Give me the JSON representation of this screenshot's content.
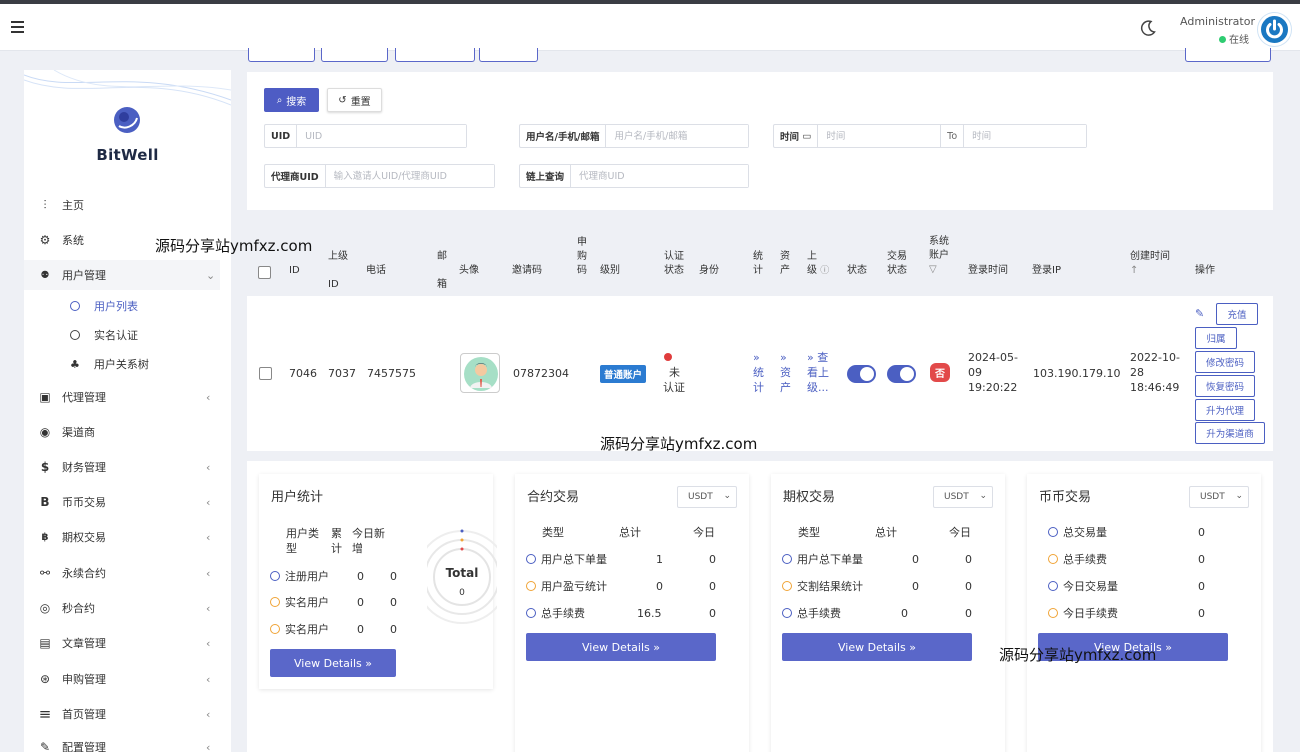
{
  "header": {
    "admin_name": "Administrator",
    "status": "在线"
  },
  "sidebar": {
    "logo": "BitWell",
    "items": [
      {
        "label": "主页",
        "icon": "chart-icon",
        "glyph": "⫶"
      },
      {
        "label": "系统",
        "icon": "gear-icon",
        "glyph": "⚙"
      },
      {
        "label": "用户管理",
        "icon": "users-icon",
        "glyph": "👥"
      },
      {
        "label": "代理管理",
        "icon": "id-card-icon",
        "glyph": "▣"
      },
      {
        "label": "渠道商",
        "icon": "user-circle-icon",
        "glyph": "◉"
      },
      {
        "label": "财务管理",
        "icon": "dollar-icon",
        "glyph": "$"
      },
      {
        "label": "币币交易",
        "icon": "bitcoin-icon",
        "glyph": "B"
      },
      {
        "label": "期权交易",
        "icon": "bitcoin-small-icon",
        "glyph": "฿"
      },
      {
        "label": "永续合约",
        "icon": "link-icon",
        "glyph": "⚯"
      },
      {
        "label": "秒合约",
        "icon": "target-icon",
        "glyph": "◎"
      },
      {
        "label": "文章管理",
        "icon": "newspaper-icon",
        "glyph": "▤"
      },
      {
        "label": "申购管理",
        "icon": "lifebuoy-icon",
        "glyph": "⊛"
      },
      {
        "label": "首页管理",
        "icon": "list-icon",
        "glyph": "≡"
      },
      {
        "label": "配置管理",
        "icon": "wrench-icon",
        "glyph": "✎"
      }
    ],
    "sub_items": [
      "用户列表",
      "实名认证",
      "用户关系树"
    ]
  },
  "filters": {
    "search_label": "搜索",
    "reset_label": "重置",
    "uid": {
      "label": "UID",
      "placeholder": "UID"
    },
    "username": {
      "label": "用户名/手机/邮箱",
      "placeholder": "用户名/手机/邮箱"
    },
    "time": {
      "label": "时间",
      "placeholder_from": "时间",
      "to": "To",
      "placeholder_to": "时间"
    },
    "agent_uid": {
      "label": "代理商UID",
      "placeholder": "输入邀请人UID/代理商UID"
    },
    "chain_query": {
      "label": "链上查询",
      "placeholder": "代理商UID"
    }
  },
  "table": {
    "headers": {
      "id": "ID",
      "parent_id_1": "上级",
      "parent_id_2": "ID",
      "phone": "电话",
      "email_1": "邮",
      "email_2": "箱",
      "avatar": "头像",
      "invite_code": "邀请码",
      "apply_code_1": "申",
      "apply_code_2": "购",
      "apply_code_3": "码",
      "level": "级别",
      "auth_1": "认证",
      "auth_2": "状态",
      "identity": "身份",
      "stats_1": "统",
      "stats_2": "计",
      "assets_1": "资",
      "assets_2": "产",
      "parent_1": "上",
      "parent_2": "级",
      "status": "状态",
      "trade_1": "交易",
      "trade_2": "状态",
      "sys_1": "系统",
      "sys_2": "账户",
      "login_time": "登录时间",
      "login_ip": "登录IP",
      "created": "创建时间",
      "ops": "操作"
    },
    "row": {
      "id": "7046",
      "parent_id": "7037",
      "phone": "7457575",
      "invite_code": "07872304",
      "level": "普通账户",
      "auth_1": "未",
      "auth_2": "认证",
      "stats_1": "统",
      "stats_2": "计",
      "assets_1": "资",
      "assets_2": "产",
      "parent_1": "查",
      "parent_2": "看上",
      "parent_3": "级...",
      "sys_account": "否",
      "login_time_1": "2024-05-",
      "login_time_2": "09",
      "login_time_3": "19:20:22",
      "login_ip": "103.190.179.10",
      "created_1": "2022-10-",
      "created_2": "28",
      "created_3": "18:46:49",
      "ops": [
        "充值",
        "归属",
        "修改密码",
        "恢复密码",
        "升为代理",
        "升为渠道商"
      ]
    }
  },
  "user_stats": {
    "title": "用户统计",
    "col_type_1": "用户类",
    "col_type_2": "型",
    "col_total_1": "累",
    "col_total_2": "计",
    "col_today_1": "今日新",
    "col_today_2": "增",
    "rows": [
      {
        "label": "注册用户",
        "total": "0",
        "today": "0"
      },
      {
        "label": "实名用户",
        "total": "0",
        "today": "0"
      },
      {
        "label": "实名用户",
        "total": "0",
        "today": "0"
      }
    ],
    "ring_label": "Total",
    "ring_value": "0",
    "details": "View Details"
  },
  "contract": {
    "title": "合约交易",
    "currency": "USDT",
    "col_type": "类型",
    "col_total": "总计",
    "col_today": "今日",
    "rows": [
      {
        "label": "用户总下单量",
        "total": "1",
        "today": "0"
      },
      {
        "label": "用户盈亏统计",
        "total": "0",
        "today": "0"
      },
      {
        "label": "总手续费",
        "total": "16.5",
        "today": "0"
      }
    ],
    "details": "View Details"
  },
  "options": {
    "title": "期权交易",
    "currency": "USDT",
    "col_type": "类型",
    "col_total": "总计",
    "col_today": "今日",
    "rows": [
      {
        "label": "用户总下单量",
        "total": "0",
        "today": "0"
      },
      {
        "label": "交割结果统计",
        "total": "0",
        "today": "0"
      },
      {
        "label": "总手续费",
        "total": "0",
        "today": "0"
      }
    ],
    "details": "View Details"
  },
  "spot": {
    "title": "币币交易",
    "currency": "USDT",
    "rows": [
      {
        "label": "总交易量",
        "value": "0"
      },
      {
        "label": "总手续费",
        "value": "0"
      },
      {
        "label": "今日交易量",
        "value": "0"
      },
      {
        "label": "今日手续费",
        "value": "0"
      }
    ],
    "details": "View Details"
  },
  "watermark": "源码分享站ymfxz.com",
  "colors": {
    "primary": "#4e5cc4",
    "badge_blue": "#2b7bd1",
    "danger": "#e24a4a",
    "online": "#2ecc71"
  }
}
